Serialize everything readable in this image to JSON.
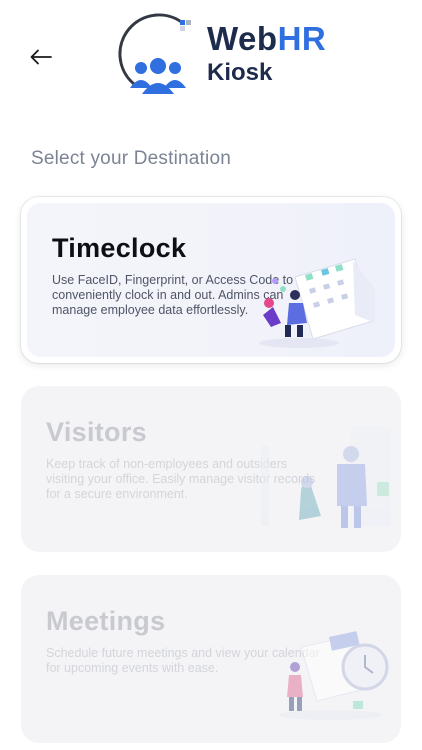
{
  "header": {
    "back_icon": "arrow-left-icon",
    "logo": {
      "title_main": "Web",
      "title_accent": "HR",
      "subtitle": "Kiosk"
    }
  },
  "section_title": "Select your Destination",
  "destinations": [
    {
      "title": "Timeclock",
      "description": "Use FaceID, Fingerprint, or Access Code to conveniently clock in and out. Admins can manage employee data effortlessly.",
      "icon": "timeclock-illustration",
      "state": "enabled"
    },
    {
      "title": "Visitors",
      "description": "Keep track of non-employees and outsiders visiting your office. Easily manage visitor records for a secure environment.",
      "icon": "visitors-illustration",
      "state": "disabled"
    },
    {
      "title": "Meetings",
      "description": "Schedule future meetings and view your calendar for upcoming events with ease.",
      "icon": "meetings-illustration",
      "state": "disabled"
    }
  ],
  "colors": {
    "brand_dark": "#1d2b4c",
    "brand_blue": "#2f6fe0",
    "section_title": "#7b8394",
    "disabled_text": "#c8cacf"
  }
}
